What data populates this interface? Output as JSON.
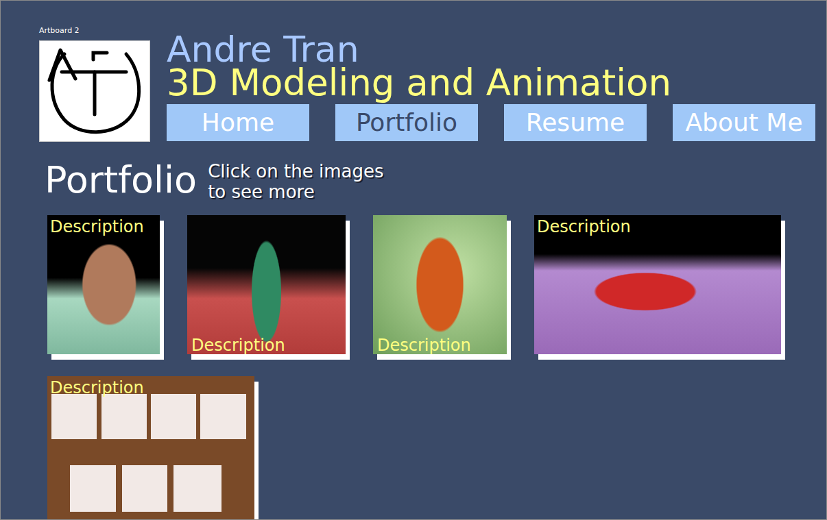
{
  "artboard": {
    "label": "Artboard 2"
  },
  "header": {
    "name": "Andre Tran",
    "subtitle": "3D Modeling and Animation"
  },
  "nav": [
    {
      "label": "Home",
      "selected": false
    },
    {
      "label": "Portfolio",
      "selected": true
    },
    {
      "label": "Resume",
      "selected": false
    },
    {
      "label": "About Me",
      "selected": false
    }
  ],
  "page": {
    "title": "Portfolio",
    "hint_lines": [
      "Click on the images",
      "to see more"
    ]
  },
  "gallery": [
    {
      "caption": "Description",
      "kind": "top"
    },
    {
      "caption": "Description",
      "kind": "bottom"
    },
    {
      "caption": "Description",
      "kind": "bottom"
    },
    {
      "caption": "Description",
      "kind": "top"
    },
    {
      "caption": "Description",
      "kind": "top"
    }
  ]
}
